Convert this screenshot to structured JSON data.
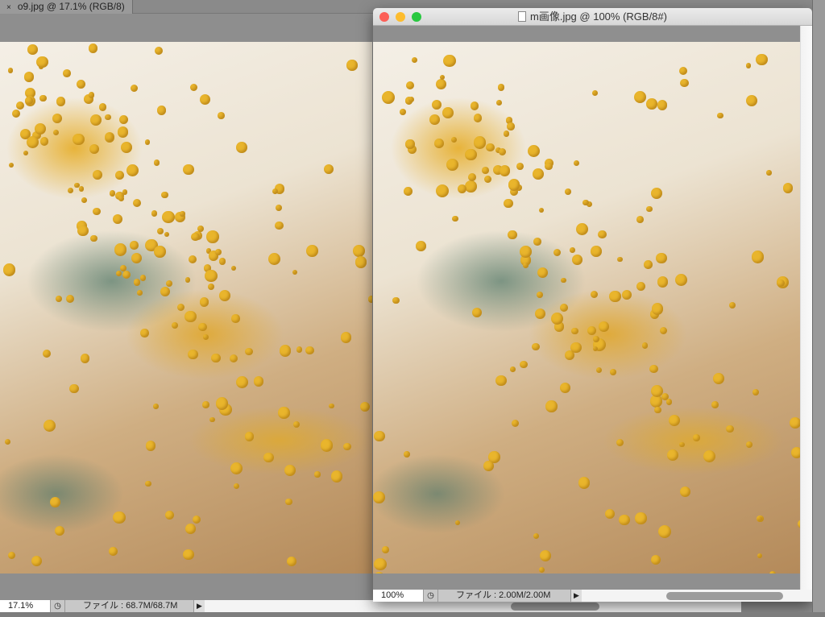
{
  "left_doc": {
    "tab_title": "o9.jpg @ 17.1% (RGB/8)",
    "close_glyph": "×",
    "zoom": "17.1%",
    "file_info": "ファイル : 68.7M/68.7M"
  },
  "right_doc": {
    "window_title": "m画像.jpg @ 100% (RGB/8#)",
    "zoom": "100%",
    "file_info": "ファイル : 2.00M/2.00M"
  },
  "colors": {
    "close": "#fc5f57",
    "minimize": "#fdbc2e",
    "zoom": "#28c840",
    "flower": "#e9b52c"
  }
}
